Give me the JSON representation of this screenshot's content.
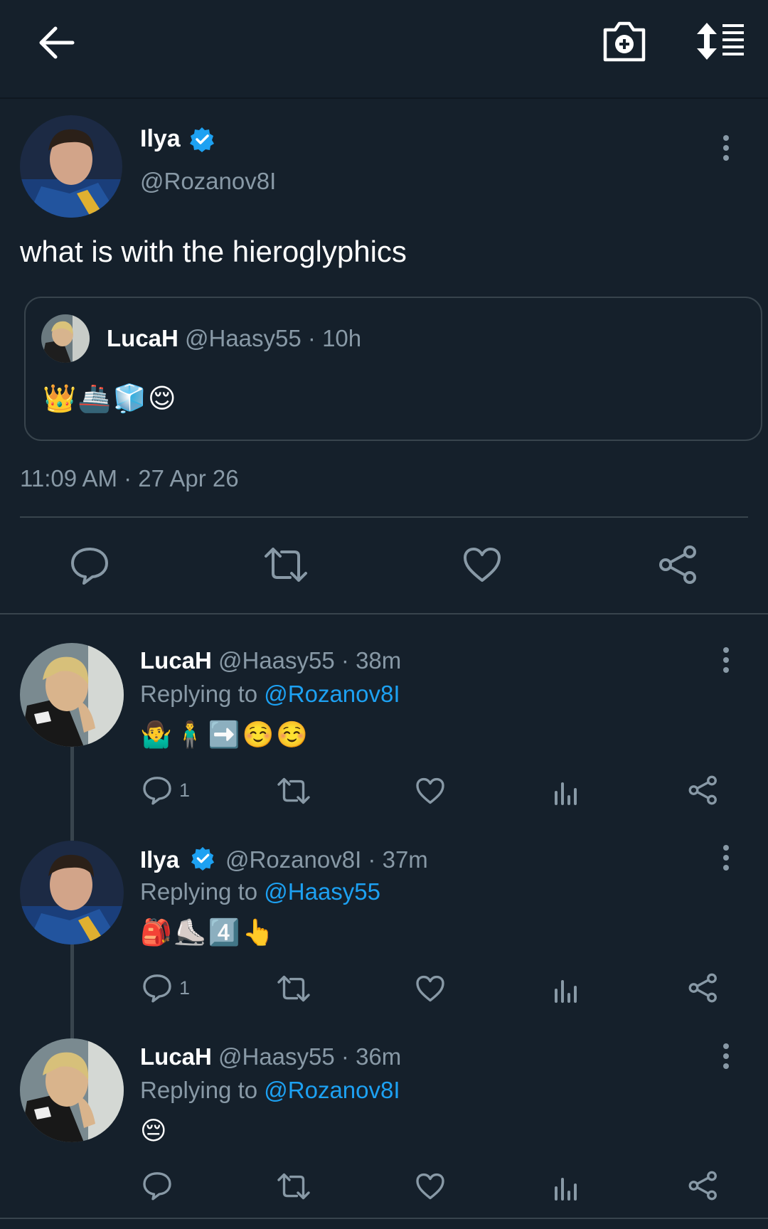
{
  "header": {
    "back_icon": "arrow-left-icon",
    "camera_icon": "camera-plus-icon",
    "sort_icon": "sort-list-icon"
  },
  "tweet": {
    "name": "Ilya",
    "handle": "@Rozanov8I",
    "text": "what is with the hieroglyphics",
    "timestamp": "11:09 AM · 27 Apr 26",
    "quote": {
      "name": "LucaH",
      "handle_time": "@Haasy55 · 10h",
      "emojis": "👑🚢🧊😌"
    }
  },
  "replies": [
    {
      "name": "LucaH",
      "meta": "@Haasy55 · 38m",
      "replying_prefix": "Replying to ",
      "replying_to": "@Rozanov8I",
      "emojis": "🤷‍♂️🧍‍♂️➡️☺️☺️",
      "reply_count": "1"
    },
    {
      "name": "Ilya",
      "meta": "@Rozanov8I · 37m",
      "replying_prefix": "Replying to ",
      "replying_to": "@Haasy55",
      "emojis": "🎒⛸️4️⃣👆",
      "reply_count": "1"
    },
    {
      "name": "LucaH",
      "meta": "@Haasy55 · 36m",
      "replying_prefix": "Replying to ",
      "replying_to": "@Rozanov8I",
      "emojis": "😔",
      "reply_count": ""
    }
  ],
  "colors": {
    "background": "#15202b",
    "muted": "#8899a6",
    "accent": "#1da1f2",
    "divider": "#38444d"
  }
}
